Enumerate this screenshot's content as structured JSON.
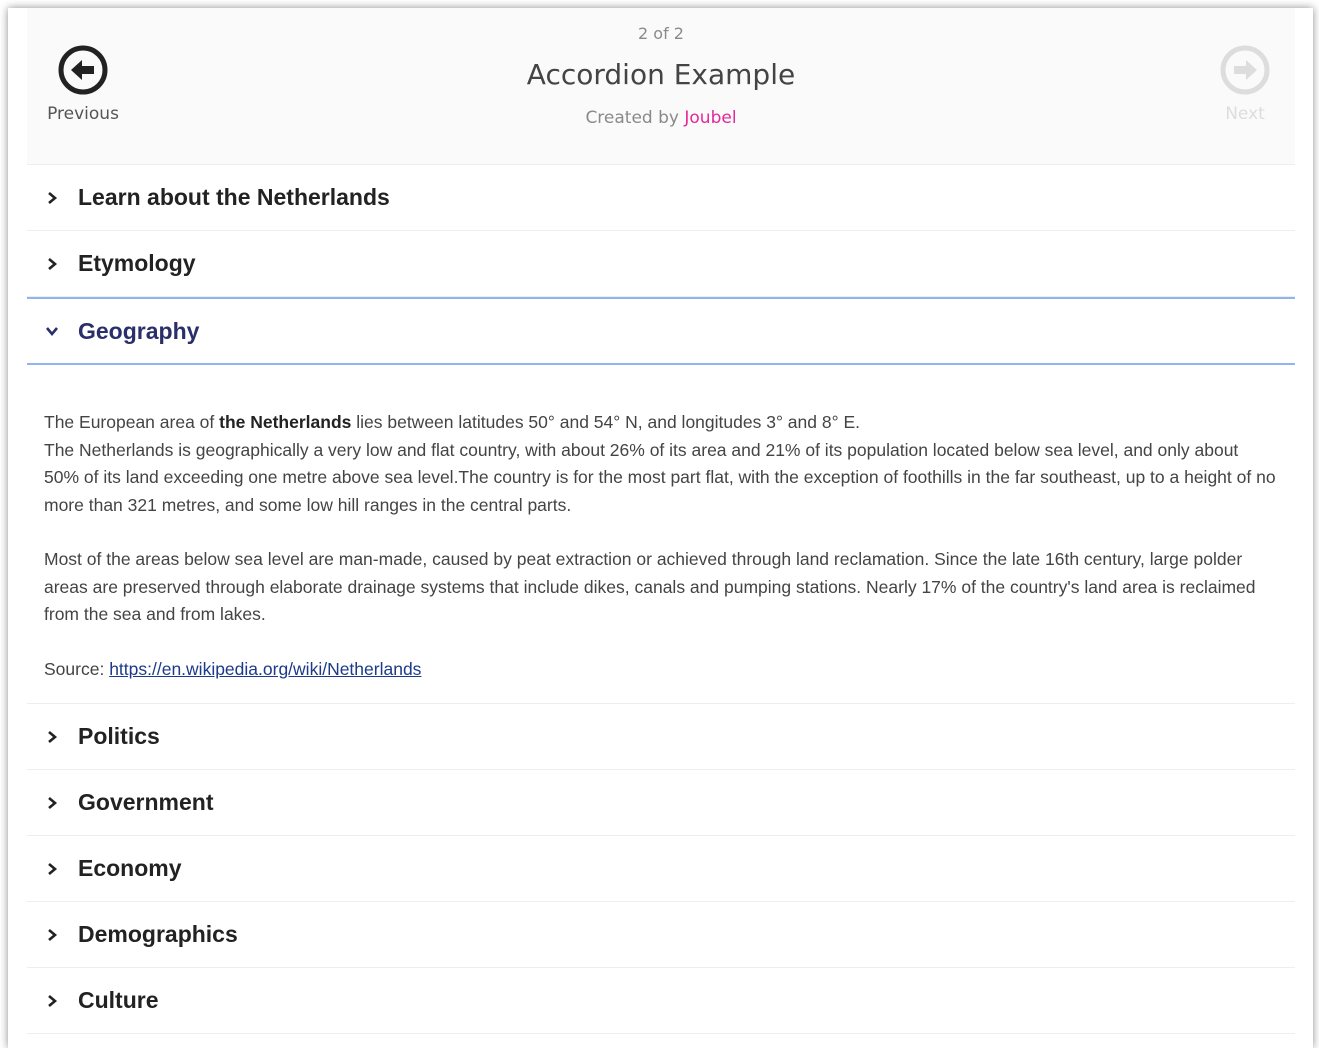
{
  "header": {
    "counter": "2 of 2",
    "title": "Accordion Example",
    "created_by_label": "Created by",
    "author": "Joubel",
    "previous_label": "Previous",
    "next_label": "Next"
  },
  "accordion": {
    "items": [
      {
        "label": "Learn about the Netherlands",
        "expanded": false
      },
      {
        "label": "Etymology",
        "expanded": false
      },
      {
        "label": "Geography",
        "expanded": true
      },
      {
        "label": "Politics",
        "expanded": false
      },
      {
        "label": "Government",
        "expanded": false
      },
      {
        "label": "Economy",
        "expanded": false
      },
      {
        "label": "Demographics",
        "expanded": false
      },
      {
        "label": "Culture",
        "expanded": false
      }
    ],
    "geography_panel": {
      "p1_prefix": "The European area of ",
      "p1_bold": "the Netherlands",
      "p1_suffix": " lies between latitudes 50° and 54° N, and longitudes 3° and 8° E.",
      "p1_line2": "The Netherlands is geographically a very low and flat country, with about 26% of its area and 21% of its population located below sea level, and only about 50% of its land exceeding one metre above sea level.The country is for the most part flat, with the exception of foothills in the far southeast, up to a height of no more than 321 metres, and some low hill ranges in the central parts.",
      "p2": "Most of the areas below sea level are man-made, caused by peat extraction or achieved through land reclamation. Since the late 16th century, large polder areas are preserved through elaborate drainage systems that include dikes, canals and pumping stations. Nearly 17% of the country's land area is reclaimed from the sea and from lakes.",
      "source_label": "Source: ",
      "source_link": "https://en.wikipedia.org/wiki/Netherlands"
    }
  },
  "colors": {
    "author_link": "#e6279a",
    "open_border": "#8fb4f0",
    "open_label": "#2a2f6a",
    "link": "#1d3a8a"
  },
  "icons": {
    "previous": "arrow-left-circle-icon",
    "next": "arrow-right-circle-icon",
    "collapsed": "chevron-right-icon",
    "expanded": "chevron-down-icon"
  }
}
